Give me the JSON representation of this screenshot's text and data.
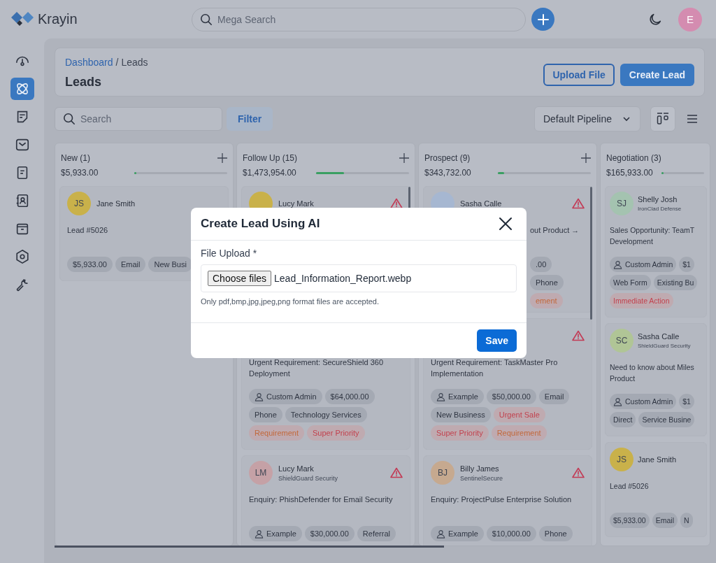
{
  "topbar": {
    "brand": "Krayin",
    "search_placeholder": "Mega Search",
    "user_initial": "E"
  },
  "sidebar": {
    "items": [
      {
        "kind": "dashboard",
        "selected": false
      },
      {
        "kind": "leads",
        "selected": true
      },
      {
        "kind": "quotes",
        "selected": false
      },
      {
        "kind": "mail",
        "selected": false
      },
      {
        "kind": "activities",
        "selected": false
      },
      {
        "kind": "contacts",
        "selected": false
      },
      {
        "kind": "products",
        "selected": false
      },
      {
        "kind": "settings",
        "selected": false
      },
      {
        "kind": "configuration",
        "selected": false
      }
    ]
  },
  "header": {
    "breadcrumb": [
      "Dashboard",
      "Leads"
    ],
    "breadcrumb_separator": "/",
    "title": "Leads",
    "upload_button": "Upload File",
    "create_button": "Create Lead"
  },
  "toolbar": {
    "search_placeholder": "Search",
    "filter": "Filter",
    "pipeline": "Default Pipeline",
    "views": [
      {
        "kind": "kanban",
        "selected": true
      },
      {
        "kind": "list",
        "selected": false
      }
    ]
  },
  "columns": [
    {
      "title": "New (1)",
      "amount": "$5,933.00",
      "level": 0.01,
      "add_button": true,
      "cards": [
        {
          "kind": "full",
          "initials": "JS",
          "color": "#c9b14a",
          "name": "Jane Smith",
          "alert": false,
          "title": "Lead #5026",
          "tags": [
            {
              "kind": "plain",
              "text": "$5,933.00"
            },
            {
              "kind": "plain",
              "text": "Email"
            },
            {
              "kind": "plain",
              "text": "New Busi"
            }
          ]
        }
      ]
    },
    {
      "title": "Follow Up (15)",
      "amount": "$1,473,954.00",
      "level": 0.3,
      "add_button": true,
      "cards": [
        {
          "kind": "covered",
          "color": "#c9b14a",
          "name": "Lucy Mark",
          "alert": true
        },
        {
          "kind": "full",
          "alert": false,
          "title": "Urgent Requirement: SecureShield 360 Deployment",
          "tags": [
            {
              "kind": "person",
              "text": "Custom Admin"
            },
            {
              "kind": "plain",
              "text": "$64,000.00"
            },
            {
              "kind": "plain",
              "text": "Phone"
            },
            {
              "kind": "plain",
              "text": "Technology Services"
            },
            {
              "kind": "label",
              "text": "Requirement",
              "color": "#c2683a"
            },
            {
              "kind": "label",
              "text": "Super Priority",
              "color": "#c2424e"
            }
          ]
        },
        {
          "kind": "full",
          "initials": "LM",
          "color": "#c5a1a6",
          "name": "Lucy Mark",
          "org": "ShieldGuard Security",
          "alert": true,
          "title": "Enquiry: PhishDefender for Email Security",
          "tags": [
            {
              "kind": "person",
              "text": "Example"
            },
            {
              "kind": "plain",
              "text": "$30,000.00"
            },
            {
              "kind": "plain",
              "text": "Referral"
            }
          ]
        }
      ]
    },
    {
      "title": "Prospect (9)",
      "amount": "$343,732.00",
      "level": 0.07,
      "add_button": true,
      "cards": [
        {
          "kind": "covered",
          "color": "#a6b7d1",
          "name": "Sasha Calle",
          "alert": true,
          "title": "out Product →",
          "tags": [
            {
              "kind": "plain",
              "text": ".00"
            },
            {
              "kind": "plain",
              "text": "Phone"
            },
            {
              "kind": "label",
              "text": "ement",
              "color": "#c2683a"
            }
          ]
        },
        {
          "kind": "full",
          "alert": true,
          "title": "Urgent Requirement: TaskMaster Pro Implementation",
          "tags": [
            {
              "kind": "person",
              "text": "Example"
            },
            {
              "kind": "plain",
              "text": "$50,000.00"
            },
            {
              "kind": "plain",
              "text": "Email"
            },
            {
              "kind": "plain",
              "text": "New Business"
            },
            {
              "kind": "label",
              "text": "Urgent Sale",
              "color": "#c2424e"
            },
            {
              "kind": "label",
              "text": "Super Priority",
              "color": "#c2424e"
            },
            {
              "kind": "label",
              "text": "Requirement",
              "color": "#c2683a"
            }
          ]
        },
        {
          "kind": "full",
          "initials": "BJ",
          "color": "#c6a98f",
          "name": "Billy James",
          "org": "SentinelSecure",
          "alert": true,
          "title": "Enquiry: ProjectPulse Enterprise Solution",
          "tags": [
            {
              "kind": "person",
              "text": "Example"
            },
            {
              "kind": "plain",
              "text": "$10,000.00"
            },
            {
              "kind": "plain",
              "text": "Phone"
            }
          ]
        }
      ]
    },
    {
      "title": "Negotiation (3)",
      "amount": "$165,933.00",
      "level": 0.03,
      "add_button": false,
      "cards": [
        {
          "kind": "full",
          "initials": "SJ",
          "color": "#a4c3b0",
          "name": "Shelly Josh",
          "org": "IronClad Defense",
          "alert": false,
          "title": "Sales Opportunity: TeamT\nDevelopment",
          "tags": [
            {
              "kind": "person",
              "text": "Custom Admin"
            },
            {
              "kind": "plain",
              "text": "$1"
            },
            {
              "kind": "plain",
              "text": "Web Form"
            },
            {
              "kind": "plain",
              "text": "Existing Bu"
            },
            {
              "kind": "label",
              "text": "Immediate Action",
              "color": "#c2424e"
            }
          ]
        },
        {
          "kind": "full",
          "initials": "SC",
          "color": "#b0c596",
          "name": "Sasha Calle",
          "org": "ShieldGuard Security",
          "alert": false,
          "title": "Need to know about Miles\nProduct",
          "tags": [
            {
              "kind": "person",
              "text": "Custom Admin"
            },
            {
              "kind": "plain",
              "text": "$1"
            },
            {
              "kind": "plain",
              "text": "Direct"
            },
            {
              "kind": "plain",
              "text": "Service Busine"
            }
          ]
        },
        {
          "kind": "full",
          "initials": "JS",
          "color": "#c9b14a",
          "name": "Jane Smith",
          "alert": false,
          "title": "Lead #5026",
          "tags": [
            {
              "kind": "plain",
              "text": "$5,933.00"
            },
            {
              "kind": "plain",
              "text": "Email"
            },
            {
              "kind": "plain",
              "text": "N"
            }
          ]
        }
      ]
    }
  ],
  "dialog": {
    "title": "Create Lead Using AI",
    "field_label": "File Upload *",
    "choose_button": "Choose files",
    "file_name": "Lead_Information_Report.webp",
    "hint": "Only pdf,bmp,jpg,jpeg,png format files are accepted.",
    "save_button": "Save"
  }
}
